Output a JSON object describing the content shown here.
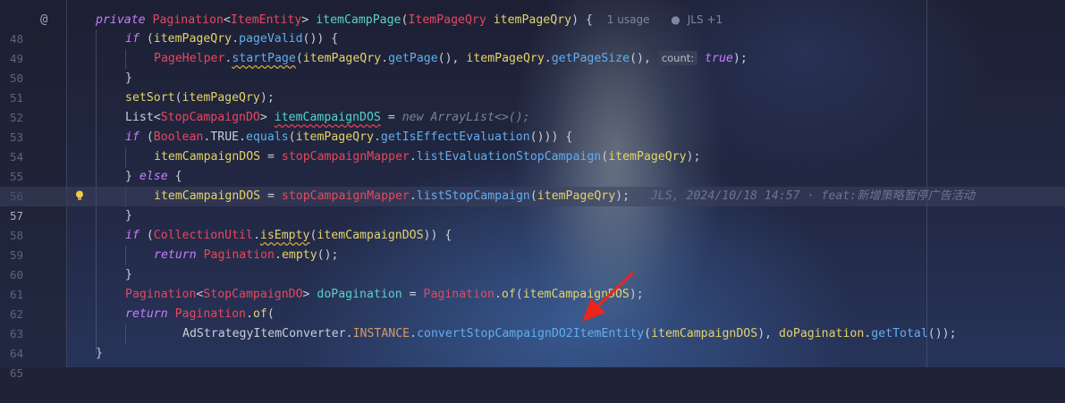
{
  "editor": {
    "line_numbers": [
      "48",
      "49",
      "50",
      "51",
      "52",
      "53",
      "54",
      "55",
      "56",
      "57",
      "58",
      "59",
      "60",
      "61",
      "62",
      "63",
      "64",
      "65"
    ],
    "current_line": "57",
    "gutter_icons": {
      "line48": "at-override-icon",
      "line57": "lightbulb-icon"
    },
    "l48": {
      "private": "private",
      "ret": "Pagination",
      "lt": "<",
      "gen": "ItemEntity",
      "gt": ">",
      "method": "itemCampPage",
      "open": "(",
      "ptype": "ItemPageQry",
      "pname": "itemPageQry",
      "close": ") {",
      "usage": "1 usage",
      "author": "JLS +1"
    },
    "l49": {
      "if": "if",
      "open": " (",
      "var": "itemPageQry",
      "dot": ".",
      "call": "pageValid",
      "close": "()) {"
    },
    "l50": {
      "cls": "PageHelper",
      "dot": ".",
      "call": "startPage",
      "open": "(",
      "var1": "itemPageQry",
      "dot2": ".",
      "call2": "getPage",
      "mid": "(), ",
      "var2": "itemPageQry",
      "dot3": ".",
      "call3": "getPageSize",
      "end": "(), ",
      "hint": "count:",
      "val": "true",
      "close": ");"
    },
    "l51": {
      "text": "}"
    },
    "l52": {
      "call": "setSort",
      "open": "(",
      "var": "itemPageQry",
      "close": ");"
    },
    "l53": {
      "type": "List",
      "lt": "<",
      "gen": "StopCampaignDO",
      "gt": ">",
      "var": "itemCampaignDOS",
      "eq": " = ",
      "new": "new",
      "rest": " ArrayList<>();"
    },
    "l54": {
      "if": "if",
      "open": " (",
      "cls": "Boolean",
      "dot": ".",
      "cst": "TRUE",
      "dot2": ".",
      "call": "equals",
      "open2": "(",
      "var": "itemPageQry",
      "dot3": ".",
      "call2": "getIsEffectEvaluation",
      "close": "())) {"
    },
    "l55": {
      "var": "itemCampaignDOS",
      "eq": " = ",
      "fld": "stopCampaignMapper",
      "dot": ".",
      "call": "listEvaluationStopCampaign",
      "open": "(",
      "arg": "itemPageQry",
      "close": ");"
    },
    "l56": {
      "brace": "} ",
      "else": "else",
      "open": " {"
    },
    "l57": {
      "var": "itemCampaignDOS",
      "eq": " = ",
      "fld": "stopCampaignMapper",
      "dot": ".",
      "call": "listStopCampaign",
      "open": "(",
      "arg": "itemPageQry",
      "close": ");",
      "blame": "JLS, 2024/10/18 14:57 · feat:新增策略暂停广告活动"
    },
    "l58": {
      "text": "}"
    },
    "l59": {
      "if": "if",
      "open": " (",
      "cls": "CollectionUtil",
      "dot": ".",
      "call": "isEmpty",
      "open2": "(",
      "var": "itemCampaignDOS",
      "close": ")) {"
    },
    "l60": {
      "return": "return",
      "cls": "Pagination",
      "dot": ".",
      "call": "empty",
      "close": "();"
    },
    "l61": {
      "text": "}"
    },
    "l62": {
      "type": "Pagination",
      "lt": "<",
      "gen": "StopCampaignDO",
      "gt": ">",
      "var": "doPagination",
      "eq": " = ",
      "cls": "Pagination",
      "dot": ".",
      "call": "of",
      "open": "(",
      "arg": "itemCampaignDOS",
      "close": ");"
    },
    "l63": {
      "return": "return",
      "cls": "Pagination",
      "dot": ".",
      "call": "of",
      "open": "("
    },
    "l64": {
      "cls": "AdStrategyItemConverter",
      "dot": ".",
      "cst": "INSTANCE",
      "dot2": ".",
      "call": "convertStopCampaignDO2ItemEntity",
      "open": "(",
      "arg": "itemCampaignDOS",
      "sep": "), ",
      "var": "doPagination",
      "dot3": ".",
      "call2": "getTotal",
      "close": "());"
    },
    "l65": {
      "text": "}"
    }
  },
  "colors": {
    "background": "#1f2336",
    "keyword": "#c77dff",
    "type": "#e8475f",
    "method": "#61aeee",
    "variable": "#e4d36a",
    "annotation_arrow": "#e8261c"
  }
}
